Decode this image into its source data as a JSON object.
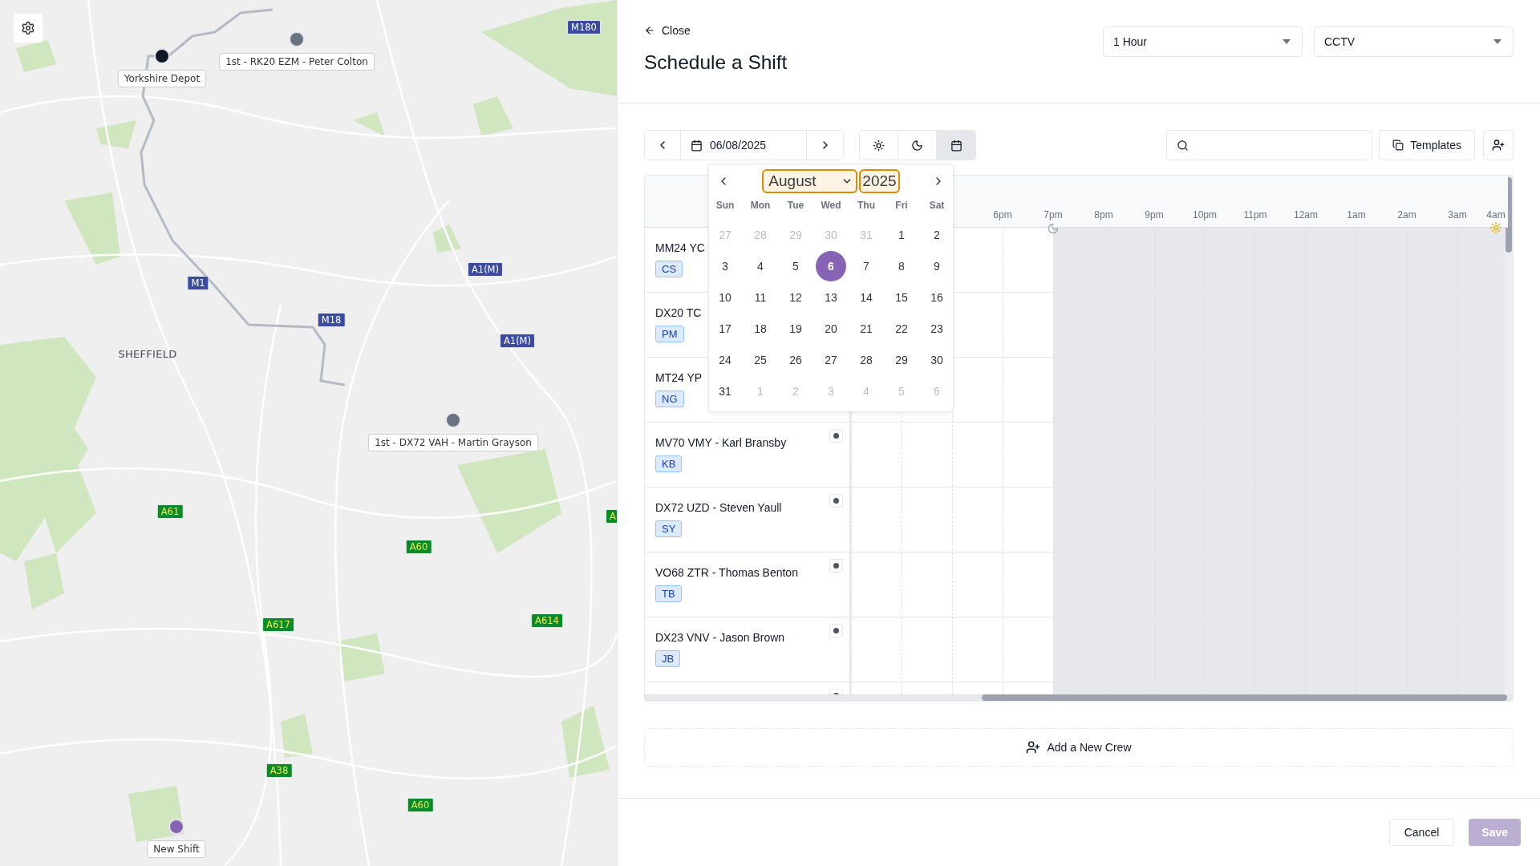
{
  "map": {
    "place_label": "SHEFFIELD",
    "markers": [
      {
        "label": "Yorkshire Depot",
        "kind": "depot"
      },
      {
        "label": "1st - RK20 EZM - Peter Colton",
        "kind": "vehicle"
      },
      {
        "label": "1st - DX72 VAH - Martin Grayson",
        "kind": "vehicle"
      },
      {
        "label": "New Shift",
        "kind": "new"
      }
    ],
    "road_shields": [
      {
        "label": "M180",
        "kind": "motorway"
      },
      {
        "label": "M1",
        "kind": "motorway"
      },
      {
        "label": "M18",
        "kind": "motorway"
      },
      {
        "label": "A1(M)",
        "kind": "motorway"
      },
      {
        "label": "A1(M)",
        "kind": "motorway"
      },
      {
        "label": "A61",
        "kind": "primary"
      },
      {
        "label": "A60",
        "kind": "primary"
      },
      {
        "label": "A617",
        "kind": "primary"
      },
      {
        "label": "A614",
        "kind": "primary"
      },
      {
        "label": "A38",
        "kind": "primary"
      },
      {
        "label": "A60",
        "kind": "primary"
      },
      {
        "label": "A",
        "kind": "primary"
      }
    ]
  },
  "header": {
    "back_link": "Close",
    "title": "Schedule a Shift",
    "selects": [
      {
        "value": "1 Hour"
      },
      {
        "value": "CCTV"
      }
    ]
  },
  "toolbar": {
    "date": "06/08/2025",
    "views": [
      {
        "kind": "day",
        "selected": false
      },
      {
        "kind": "night",
        "selected": false
      },
      {
        "kind": "calendar",
        "selected": true
      }
    ],
    "templates": "Templates"
  },
  "calendar": {
    "month": "August",
    "year": "2025",
    "weekdays": [
      "Sun",
      "Mon",
      "Tue",
      "Wed",
      "Thu",
      "Fri",
      "Sat"
    ],
    "weeks": [
      [
        {
          "day": "27",
          "outside": true,
          "selected": false
        },
        {
          "day": "28",
          "outside": true,
          "selected": false
        },
        {
          "day": "29",
          "outside": true,
          "selected": false
        },
        {
          "day": "30",
          "outside": true,
          "selected": false
        },
        {
          "day": "31",
          "outside": true,
          "selected": false
        },
        {
          "day": "1",
          "outside": false,
          "selected": false
        },
        {
          "day": "2",
          "outside": false,
          "selected": false
        }
      ],
      [
        {
          "day": "3",
          "outside": false,
          "selected": false
        },
        {
          "day": "4",
          "outside": false,
          "selected": false
        },
        {
          "day": "5",
          "outside": false,
          "selected": false
        },
        {
          "day": "6",
          "outside": false,
          "selected": true
        },
        {
          "day": "7",
          "outside": false,
          "selected": false
        },
        {
          "day": "8",
          "outside": false,
          "selected": false
        },
        {
          "day": "9",
          "outside": false,
          "selected": false
        }
      ],
      [
        {
          "day": "10",
          "outside": false,
          "selected": false
        },
        {
          "day": "11",
          "outside": false,
          "selected": false
        },
        {
          "day": "12",
          "outside": false,
          "selected": false
        },
        {
          "day": "13",
          "outside": false,
          "selected": false
        },
        {
          "day": "14",
          "outside": false,
          "selected": false
        },
        {
          "day": "15",
          "outside": false,
          "selected": false
        },
        {
          "day": "16",
          "outside": false,
          "selected": false
        }
      ],
      [
        {
          "day": "17",
          "outside": false,
          "selected": false
        },
        {
          "day": "18",
          "outside": false,
          "selected": false
        },
        {
          "day": "19",
          "outside": false,
          "selected": false
        },
        {
          "day": "20",
          "outside": false,
          "selected": false
        },
        {
          "day": "21",
          "outside": false,
          "selected": false
        },
        {
          "day": "22",
          "outside": false,
          "selected": false
        },
        {
          "day": "23",
          "outside": false,
          "selected": false
        }
      ],
      [
        {
          "day": "24",
          "outside": false,
          "selected": false
        },
        {
          "day": "25",
          "outside": false,
          "selected": false
        },
        {
          "day": "26",
          "outside": false,
          "selected": false
        },
        {
          "day": "27",
          "outside": false,
          "selected": false
        },
        {
          "day": "28",
          "outside": false,
          "selected": false
        },
        {
          "day": "29",
          "outside": false,
          "selected": false
        },
        {
          "day": "30",
          "outside": false,
          "selected": false
        }
      ],
      [
        {
          "day": "31",
          "outside": false,
          "selected": false
        },
        {
          "day": "1",
          "outside": true,
          "selected": false
        },
        {
          "day": "2",
          "outside": true,
          "selected": false
        },
        {
          "day": "3",
          "outside": true,
          "selected": false
        },
        {
          "day": "4",
          "outside": true,
          "selected": false
        },
        {
          "day": "5",
          "outside": true,
          "selected": false
        },
        {
          "day": "6",
          "outside": true,
          "selected": false
        }
      ]
    ]
  },
  "timeline": {
    "hours": [
      {
        "kind": "plain",
        "night": false
      },
      {
        "kind": "plain",
        "night": false
      },
      {
        "kind": "plain",
        "night": false
      },
      {
        "kind": "plain",
        "label": "6pm",
        "night": false
      },
      {
        "kind": "moon",
        "label": "7pm",
        "night": true
      },
      {
        "kind": "plain",
        "label": "8pm",
        "night": true
      },
      {
        "kind": "plain",
        "label": "9pm",
        "night": true
      },
      {
        "kind": "plain",
        "label": "10pm",
        "night": true
      },
      {
        "kind": "plain",
        "label": "11pm",
        "night": true
      },
      {
        "kind": "plain",
        "label": "12am",
        "night": true
      },
      {
        "kind": "plain",
        "label": "1am",
        "night": true
      },
      {
        "kind": "plain",
        "label": "2am",
        "night": true
      },
      {
        "kind": "plain",
        "label": "3am",
        "night": true
      },
      {
        "kind": "sun",
        "label": "4am"
      }
    ],
    "rows": [
      {
        "kind": "crew",
        "name": "MM24 YC",
        "initials": "CS"
      },
      {
        "kind": "crew",
        "name": "DX20 TC",
        "initials": "PM"
      },
      {
        "kind": "crew",
        "name": "MT24 YP",
        "initials": "NG"
      },
      {
        "kind": "crew",
        "name": "MV70 VMY - Karl Bransby",
        "initials": "KB"
      },
      {
        "kind": "crew",
        "name": "DX72 UZD - Steven Yaull",
        "initials": "SY"
      },
      {
        "kind": "crew",
        "name": "VO68 ZTR - Thomas Benton",
        "initials": "TB"
      },
      {
        "kind": "crew",
        "name": "DX23 VNV - Jason Brown",
        "initials": "JB"
      },
      {
        "kind": "partial"
      }
    ]
  },
  "add_crew": "Add a New Crew",
  "footer": {
    "cancel": "Cancel",
    "save": {
      "label": "Save",
      "disabled": true
    }
  }
}
